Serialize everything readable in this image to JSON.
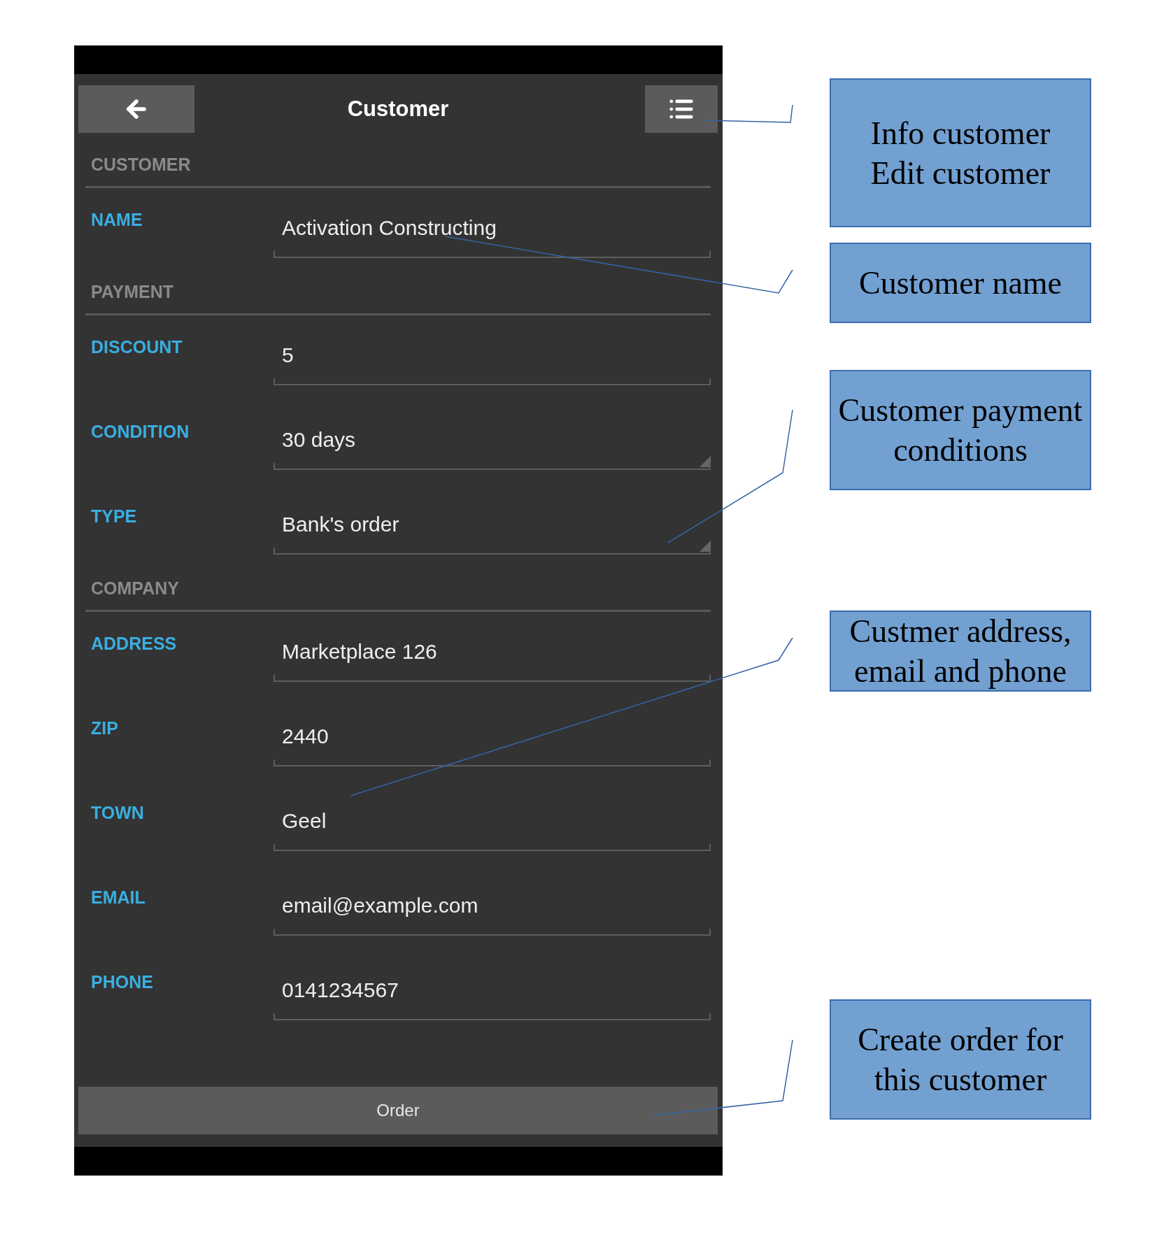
{
  "header": {
    "title": "Customer"
  },
  "sections": [
    {
      "title": "CUSTOMER",
      "fields": [
        {
          "label": "NAME",
          "value": "Activation Constructing",
          "kind": "text"
        }
      ]
    },
    {
      "title": "PAYMENT",
      "fields": [
        {
          "label": "DISCOUNT",
          "value": "5",
          "kind": "text"
        },
        {
          "label": "CONDITION",
          "value": "30 days",
          "kind": "select"
        },
        {
          "label": "TYPE",
          "value": "Bank's order",
          "kind": "select"
        }
      ]
    },
    {
      "title": "COMPANY",
      "fields": [
        {
          "label": "ADDRESS",
          "value": "Marketplace 126",
          "kind": "text"
        },
        {
          "label": "ZIP",
          "value": "2440",
          "kind": "text"
        },
        {
          "label": "TOWN",
          "value": "Geel",
          "kind": "text"
        },
        {
          "label": "EMAIL",
          "value": "email@example.com",
          "kind": "text"
        },
        {
          "label": "PHONE",
          "value": "0141234567",
          "kind": "text"
        }
      ]
    }
  ],
  "order_button": "Order",
  "callouts": [
    {
      "lines": [
        "Info customer",
        "Edit customer"
      ]
    },
    {
      "lines": [
        "Customer name"
      ]
    },
    {
      "lines": [
        "Customer payment conditions"
      ]
    },
    {
      "lines": [
        "Custmer address, email and phone"
      ]
    },
    {
      "lines": [
        "Create order for this customer"
      ]
    }
  ]
}
